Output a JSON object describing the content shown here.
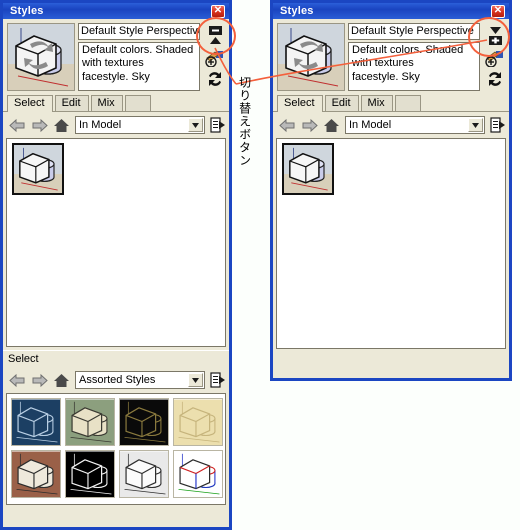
{
  "window_title": "Styles",
  "close_icon": "close-icon",
  "panels": [
    {
      "id": "left",
      "style_name": "Default Style Perspective",
      "style_description": "Default colors.  Shaded\nwith textures\nfacestyle.  Sky",
      "toggle_state": "collapse",
      "tabs": [
        {
          "label": "Select",
          "active": true
        },
        {
          "label": "Edit",
          "active": false
        },
        {
          "label": "Mix",
          "active": false
        }
      ],
      "toolbar": {
        "back_icon": "back-arrow-icon",
        "forward_icon": "forward-arrow-icon",
        "home_icon": "home-icon",
        "collection": "In Model",
        "menu_icon": "details-menu-icon"
      },
      "secondary_section": {
        "header": "Select",
        "toolbar": {
          "back_icon": "back-arrow-icon",
          "forward_icon": "forward-arrow-icon",
          "home_icon": "home-icon",
          "collection": "Assorted Styles",
          "menu_icon": "details-menu-icon"
        },
        "thumbnails": [
          {
            "name": "blueprint-style",
            "bg": "#1c3f63",
            "edge": "#b9cfe4",
            "face": "#1c3f63",
            "ground": "#1c3f63"
          },
          {
            "name": "shaded-textured-style",
            "bg": "#8c9f7e",
            "edge": "#3a3a32",
            "face": "#e8e1c6",
            "ground": "#8c9f7e"
          },
          {
            "name": "black-background-style",
            "bg": "#0a0a0a",
            "edge": "#8a7a3e",
            "face": "#0a0a0a",
            "ground": "#0a0a0a"
          },
          {
            "name": "sketchy-tan-style",
            "bg": "#ecdfae",
            "edge": "#c6b47c",
            "face": "#ecdfae",
            "ground": "#ecdfae"
          },
          {
            "name": "brick-texture-style",
            "bg": "#9a6048",
            "edge": "#2c2c2c",
            "face": "#efe9dc",
            "ground": "#9a6048"
          },
          {
            "name": "black-white-wire-style",
            "bg": "#000000",
            "edge": "#f2f2f2",
            "face": "#000000",
            "ground": "#000000"
          },
          {
            "name": "pencil-sketch-style",
            "bg": "#e9e9e9",
            "edge": "#2e2e2e",
            "face": "#fbfbfb",
            "ground": "#e9e9e9"
          },
          {
            "name": "color-by-axis-style",
            "bg": "#ffffff",
            "edge": "#2b2b2b",
            "face": "#ffffff",
            "ground": "#ffffff"
          }
        ]
      }
    },
    {
      "id": "right",
      "style_name": "Default Style Perspective",
      "style_description": "Default colors.  Shaded\nwith textures\nfacestyle.  Sky",
      "toggle_state": "expand",
      "tabs": [
        {
          "label": "Select",
          "active": true
        },
        {
          "label": "Edit",
          "active": false
        },
        {
          "label": "Mix",
          "active": false
        }
      ],
      "toolbar": {
        "back_icon": "back-arrow-icon",
        "forward_icon": "forward-arrow-icon",
        "home_icon": "home-icon",
        "collection": "In Model",
        "menu_icon": "details-menu-icon"
      }
    }
  ],
  "annotation": {
    "label": "切り替えボタン",
    "highlight_color": "#f4603c"
  },
  "colors": {
    "titlebar_blue": "#1b46c2",
    "panel_face": "#ece9d8",
    "field_white": "#ffffff",
    "close_red": "#d8301c",
    "annotation": "#f4603c"
  }
}
